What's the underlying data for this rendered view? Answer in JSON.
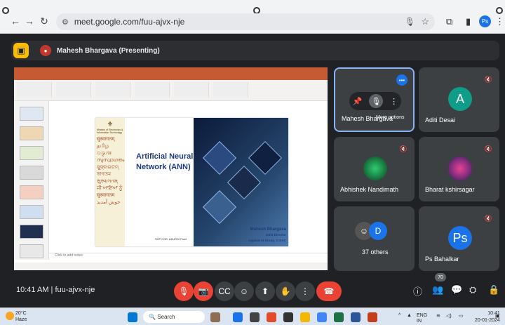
{
  "browser": {
    "url": "meet.google.com/fuu-ajvx-nje",
    "profile_initials": "Ps"
  },
  "presenting_banner": {
    "title": "Mahesh Bhargava (Presenting)"
  },
  "slide": {
    "title": "Artificial Neural Network (ANN)",
    "ministry": "Ministry of Electronics & Information Technology",
    "languages": [
      "सुस्वागतम्",
      "தமிழ",
      "ಸುಸ್ವಾಗತ",
      "സുസ്വാഗതം",
      "ସୁସ୍ବାଗତମ୍",
      "স্বাগতম",
      "સુસ્વાગતમ્",
      "ਜੀ ਆਇਆਂ ਨੂੰ",
      "सुस्वागतम",
      "خوش آمدید"
    ],
    "presenter_name": "Mahesh Bhargava",
    "presenter_role_1": "Joint Director",
    "presenter_role_2": "Applied AI Group, C-DAC",
    "footer": "SHP COE, AKURDI Pune",
    "notes_placeholder": "Click to add notes"
  },
  "participants": [
    {
      "name": "Mahesh Bhargava",
      "tooltip": "More options",
      "muted": false
    },
    {
      "name": "Aditi Desai",
      "initial": "A",
      "color": "#0f9d8a",
      "muted": true
    },
    {
      "name": "Abhishek Nandimath",
      "muted": true
    },
    {
      "name": "Bharat kshirsagar",
      "muted": true
    },
    {
      "name": "37 others",
      "initial": "D"
    },
    {
      "name": "Ps Bahalkar",
      "initial": "Ps",
      "color": "#1a73e8",
      "muted": true
    }
  ],
  "controls": {
    "time": "10:41 AM",
    "meeting_code": "fuu-ajvx-nje",
    "participant_count": "70"
  },
  "taskbar": {
    "temperature": "20°C",
    "weather": "Haze",
    "search_placeholder": "Search",
    "lang": "ENG",
    "region": "IN",
    "time": "10:41",
    "date": "20-01-2024"
  }
}
